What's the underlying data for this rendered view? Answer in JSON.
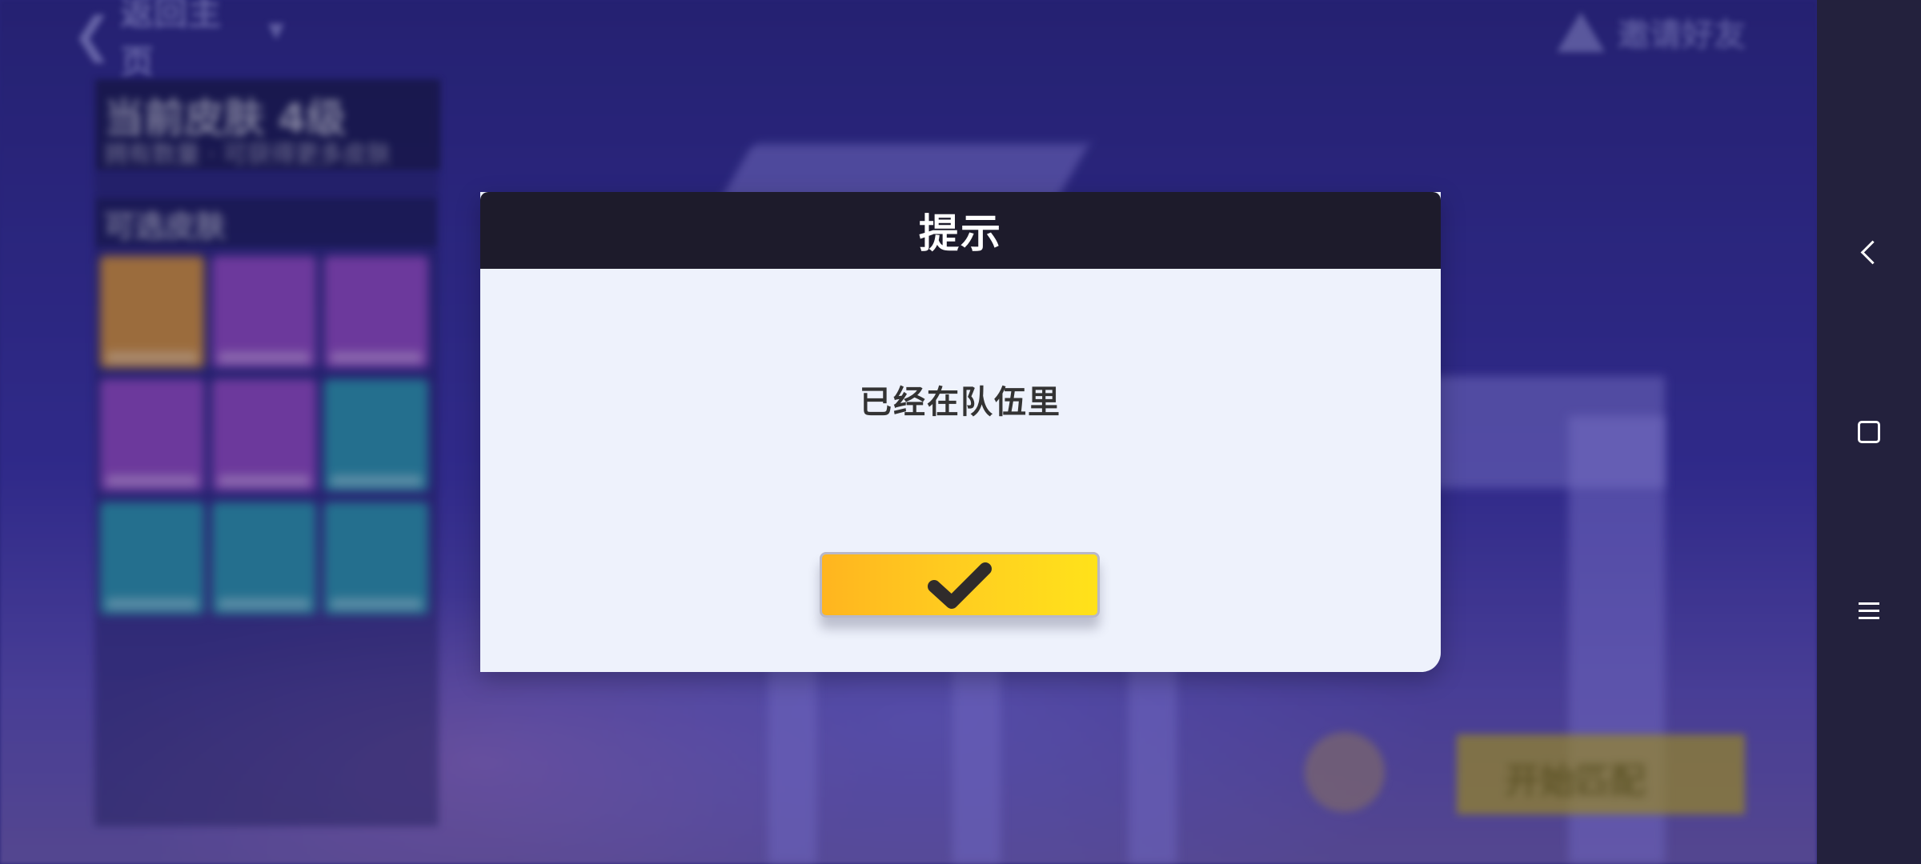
{
  "background": {
    "back_label": "返回主页",
    "right_label": "邀请好友",
    "panel_title": "当前皮肤 4级",
    "panel_subtitle": "拥有数量 · 可获得更多皮肤",
    "section_label": "可选皮肤",
    "start_label": "开始匹配"
  },
  "dialog": {
    "title": "提示",
    "message": "已经在队伍里",
    "confirm_icon": "checkmark-icon"
  },
  "navbar": {
    "back_icon": "chevron-left-icon",
    "home_icon": "square-icon",
    "menu_icon": "menu-icon"
  },
  "colors": {
    "dialog_bg": "#eef2fc",
    "header_bg": "#1d1b2b",
    "button_gradient_start": "#ffb51f",
    "button_gradient_end": "#ffe21a",
    "navbar_bg": "#23213d"
  }
}
